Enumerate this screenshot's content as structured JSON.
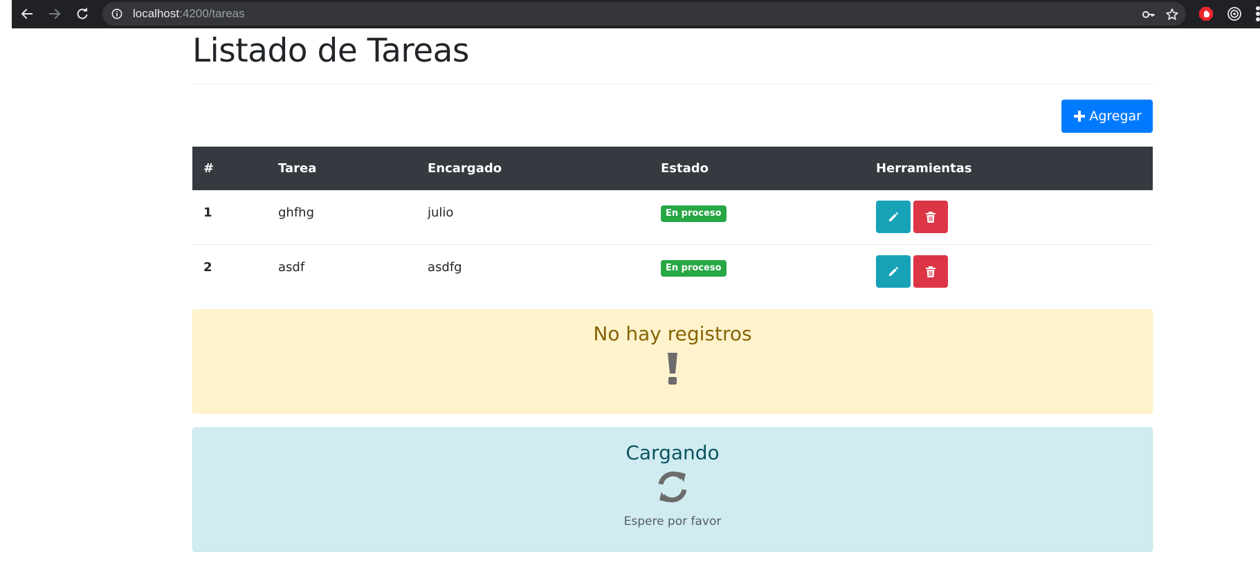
{
  "browser": {
    "url_host": "localhost",
    "url_path": ":4200/tareas"
  },
  "page": {
    "title": "Listado de Tareas",
    "add_button_label": "Agregar"
  },
  "table": {
    "headers": {
      "num": "#",
      "task": "Tarea",
      "owner": "Encargado",
      "status": "Estado",
      "tools": "Herramientas"
    },
    "rows": [
      {
        "num": "1",
        "task": "ghfhg",
        "owner": "julio",
        "status": "En proceso"
      },
      {
        "num": "2",
        "task": "asdf",
        "owner": "asdfg",
        "status": "En proceso"
      }
    ]
  },
  "alerts": {
    "empty": {
      "title": "No hay registros",
      "icon": "exclamation-icon"
    },
    "loading": {
      "title": "Cargando",
      "icon": "sync-icon",
      "message": "Espere por favor"
    }
  },
  "colors": {
    "primary": "#007bff",
    "success": "#28a745",
    "info": "#17a2b8",
    "danger": "#dc3545",
    "dark": "#343a40",
    "warning_bg": "#fff3cd",
    "info_bg": "#d1ecf1"
  },
  "icons": {
    "nav": [
      "back-arrow-icon",
      "forward-arrow-icon",
      "reload-icon"
    ],
    "omnibox": [
      "info-icon",
      "key-icon",
      "star-icon"
    ],
    "extensions": [
      "adblock-icon",
      "extension-circle-icon"
    ],
    "row_tools": [
      "pencil-icon",
      "trash-icon"
    ],
    "add": "plus-icon"
  }
}
